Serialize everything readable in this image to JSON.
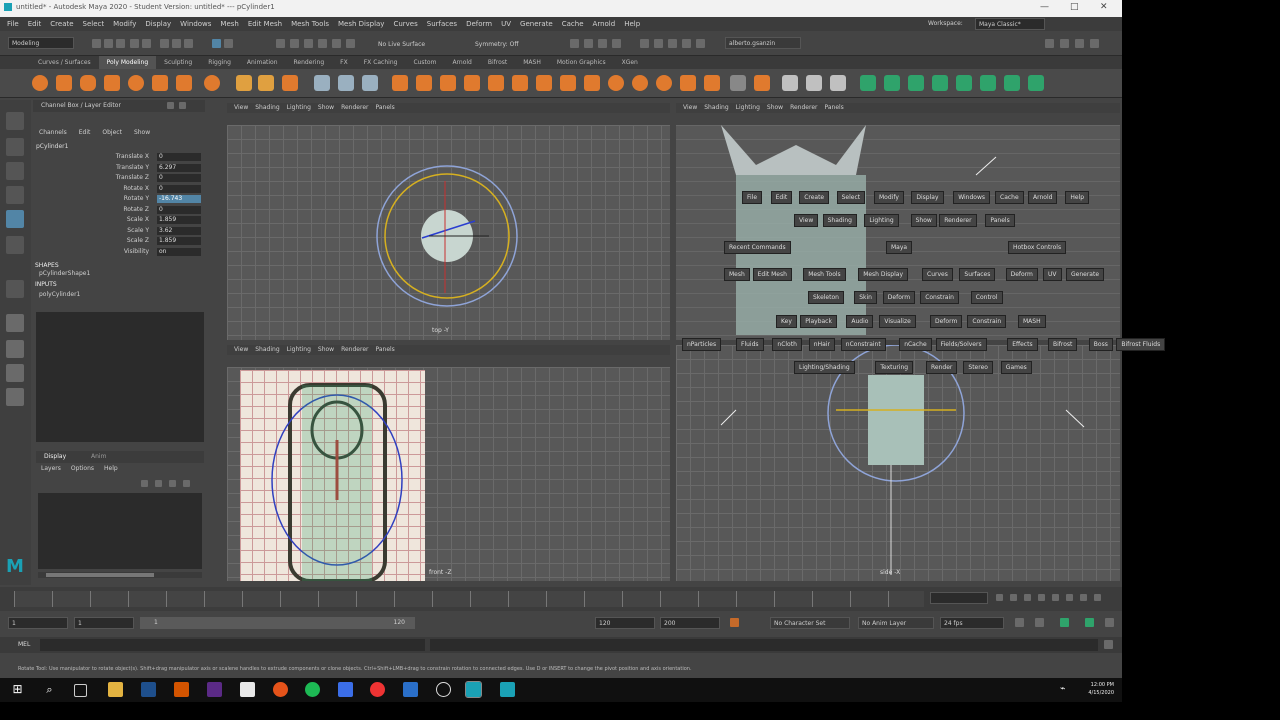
{
  "window": {
    "title": "untitled* - Autodesk Maya 2020 - Student Version: untitled* --- pCylinder1",
    "controls": [
      "—",
      "□",
      "✕"
    ]
  },
  "menubar": {
    "items": [
      "File",
      "Edit",
      "Create",
      "Select",
      "Modify",
      "Display",
      "Windows",
      "Mesh",
      "Edit Mesh",
      "Mesh Tools",
      "Mesh Display",
      "Curves",
      "Surfaces",
      "Deform",
      "UV",
      "Generate",
      "Cache",
      "Arnold",
      "Help"
    ],
    "workspace_label": "Workspace:",
    "workspace_value": "Maya Classic*"
  },
  "statusline": {
    "mode": "Modeling",
    "live_surface": "No Live Surface",
    "symmetry": "Symmetry: Off",
    "user": "alberto.gsanzin"
  },
  "shelf": {
    "tabs": [
      "Curves / Surfaces",
      "Poly Modeling",
      "Sculpting",
      "Rigging",
      "Animation",
      "Rendering",
      "FX",
      "FX Caching",
      "Custom",
      "Arnold",
      "Bifrost",
      "MASH",
      "Motion Graphics",
      "XGen"
    ],
    "active_tab": "Poly Modeling"
  },
  "channel_box": {
    "title": "Channel Box / Layer Editor",
    "menus": [
      "Channels",
      "Edit",
      "Object",
      "Show"
    ],
    "object": "pCylinder1",
    "attributes": [
      {
        "label": "Translate X",
        "value": "0"
      },
      {
        "label": "Translate Y",
        "value": "6.297"
      },
      {
        "label": "Translate Z",
        "value": "0"
      },
      {
        "label": "Rotate X",
        "value": "0"
      },
      {
        "label": "Rotate Y",
        "value": "-16.743"
      },
      {
        "label": "Rotate Z",
        "value": "0"
      },
      {
        "label": "Scale X",
        "value": "1.859"
      },
      {
        "label": "Scale Y",
        "value": "3.62"
      },
      {
        "label": "Scale Z",
        "value": "1.859"
      },
      {
        "label": "Visibility",
        "value": "on"
      }
    ],
    "selected_index": 4,
    "shapes_header": "SHAPES",
    "shape_name": "pCylinderShape1",
    "inputs_header": "INPUTS",
    "input_name": "polyCylinder1",
    "layer_tabs": [
      "Display",
      "Anim"
    ],
    "layer_menus": [
      "Layers",
      "Options",
      "Help"
    ]
  },
  "viewports": {
    "menu": [
      "View",
      "Shading",
      "Lighting",
      "Show",
      "Renderer",
      "Panels"
    ],
    "top_label": "top -Y",
    "front_label": "front -Z",
    "side_label": "side -X"
  },
  "hotbox": {
    "row1": [
      "File",
      "Edit",
      "Create",
      "Select",
      "Modify",
      "Display",
      "Windows",
      "Cache",
      "Arnold",
      "Help"
    ],
    "row2": [
      "View",
      "Shading",
      "Lighting",
      "Show",
      "Renderer",
      "Panels"
    ],
    "recent": "Recent Commands",
    "center": "Maya",
    "hotbox_controls": "Hotbox Controls",
    "row3": [
      "Mesh",
      "Edit Mesh",
      "Mesh Tools",
      "Mesh Display",
      "Curves",
      "Surfaces",
      "Deform",
      "UV",
      "Generate"
    ],
    "row4": [
      "Skeleton",
      "Skin",
      "Deform",
      "Constrain",
      "Control"
    ],
    "row5": [
      "Key",
      "Playback",
      "Audio",
      "Visualize",
      "Deform",
      "Constrain",
      "MASH"
    ],
    "row6": [
      "nParticles",
      "Fluids",
      "nCloth",
      "nHair",
      "nConstraint",
      "nCache",
      "Fields/Solvers",
      "Effects",
      "Bifrost",
      "Boss",
      "Bifrost Fluids"
    ],
    "row7": [
      "Lighting/Shading",
      "Texturing",
      "Render",
      "Stereo",
      "Games"
    ]
  },
  "range": {
    "start": "1",
    "start2": "1",
    "slider_start": "1",
    "slider_end": "120",
    "end": "120",
    "end2": "200",
    "char_set": "No Character Set",
    "anim_layer": "No Anim Layer",
    "fps": "24 fps"
  },
  "cmdline": {
    "lang": "MEL"
  },
  "helpline": {
    "text": "Rotate Tool: Use manipulator to rotate object(s). Shift+drag manipulator axis or scalene handles to extrude components or clone objects. Ctrl+Shift+LMB+drag to constrain rotation to connected edges. Use D or INSERT to change the pivot position and axis orientation."
  },
  "taskbar": {
    "time": "12:00 PM",
    "date": "4/15/2020"
  }
}
